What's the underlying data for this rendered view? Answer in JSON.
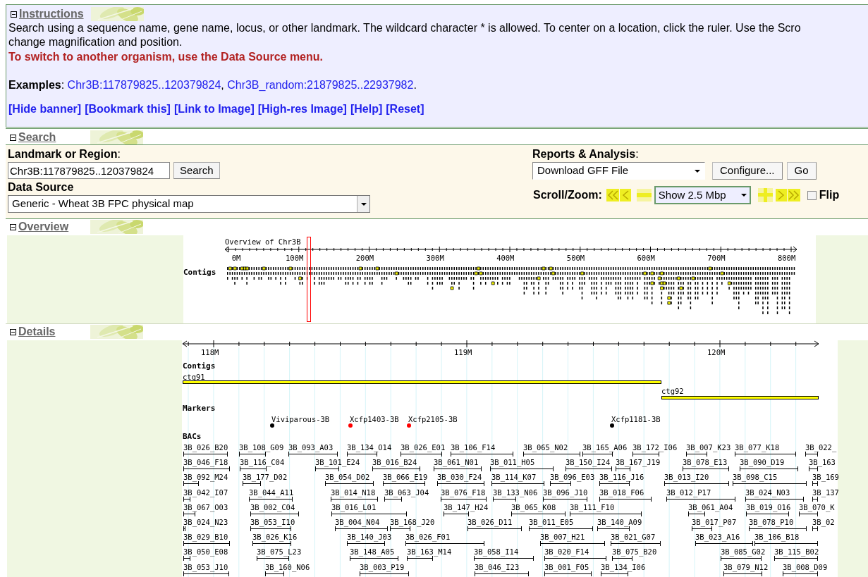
{
  "instructions": {
    "title": "Instructions",
    "expanded": true,
    "lines": [
      "Search using a sequence name, gene name, locus, or other landmark. The wildcard character * is allowed. To center on a location, click the ruler. Use the Scro",
      "change magnification and position."
    ],
    "notice": "To switch to another organism, use the Data Source menu.",
    "examples": [
      {
        "kind": "plain",
        "text": "**Examples**: "
      },
      {
        "kind": "link",
        "text": "Chr3B:117879825..120379824"
      },
      {
        "kind": "plain",
        "text": ", "
      },
      {
        "kind": "link",
        "text": "Chr3B_random:21879825..22937982"
      },
      {
        "kind": "plain",
        "text": "."
      }
    ],
    "links": [
      "[Hide banner]",
      "[Bookmark this]",
      "[Link to Image]",
      "[High-res Image]",
      "[Help]",
      "[Reset]"
    ]
  },
  "search": {
    "title": "Search",
    "expanded": true,
    "landmark_label": "**Landmark or Region**:",
    "landmark_value": "Chr3B:117879825..120379824",
    "search_button": "Search",
    "data_source_label": "Data Source",
    "data_source": "Generic - Wheat 3B FPC physical map",
    "reports_label": "**Reports & Analysis**:",
    "reports_value": "Download GFF File",
    "configure_button": "Configure...",
    "go_button": "Go",
    "scroll_zoom_label": "Scroll/Zoom:",
    "zoom_value": "Show 2.5 Mbp",
    "flip": {
      "label": "Flip",
      "checked": false
    }
  },
  "overview": {
    "title": "Overview",
    "expanded": true,
    "caption": "Overview of Chr3B",
    "ticks": [
      "0M",
      "100M",
      "200M",
      "300M",
      "400M",
      "500M",
      "600M",
      "700M",
      "800M"
    ],
    "track": "Contigs"
  },
  "details": {
    "title": "Details",
    "expanded": true,
    "ticks": [
      "118M",
      "119M",
      "120M"
    ],
    "contigs": {
      "label": "Contigs",
      "features": [
        "ctg91",
        "ctg92"
      ]
    },
    "markers": {
      "label": "Markers",
      "features": [
        {
          "label": "Viviparous-3B",
          "color": "#000000"
        },
        {
          "label": "Xcfp1403-3B",
          "color": "#ff0000"
        },
        {
          "label": "Xcfp2105-3B",
          "color": "#ff0000"
        },
        {
          "label": "Xcfp1181-3B",
          "color": "#000000"
        }
      ]
    },
    "bacs": {
      "label": "BACs",
      "features": [
        "3B_026_B20",
        "3B_108_G09",
        "3B_093_A03",
        "3B_134_O14",
        "3B_026_E01",
        "3B_106_F14",
        "3B_065_N02",
        "3B_165_A06",
        "3B_172_I06",
        "3B_007_K23",
        "3B_077_K18",
        "3B_022_",
        "3B_046_F18",
        "3B_116_C04",
        "3B_101_E24",
        "3B_016_B24",
        "3B_061_N01",
        "3B_011_H05",
        "3B_150_I24",
        "3B_167_J19",
        "3B_078_E13",
        "3B_090_D19",
        "3B_163",
        "3B_092_M24",
        "3B_177_D02",
        "3B_054_D02",
        "3B_066_E19",
        "3B_030_F24",
        "3B_114_K07",
        "3B_096_E03",
        "3B_116_J16",
        "3B_013_I20",
        "3B_098_C15",
        "3B_169",
        "3B_042_I07",
        "3B_044_A11",
        "3B_014_N18",
        "3B_063_J04",
        "3B_076_F18",
        "3B_133_N06",
        "3B_096_J10",
        "3B_018_F06",
        "3B_012_P17",
        "3B_024_N03",
        "3B_137",
        "3B_067_O03",
        "3B_002_C04",
        "3B_016_L01",
        "3B_147_H24",
        "3B_065_K08",
        "3B_111_F10",
        "3B_061_A04",
        "3B_019_O16",
        "3B_070_K",
        "3B_024_N23",
        "3B_053_I10",
        "3B_004_N04",
        "3B_168_J20",
        "3B_026_D11",
        "3B_011_E05",
        "3B_140_A09",
        "3B_017_P07",
        "3B_078_P10",
        "3B_02",
        "3B_029_B10",
        "3B_026_K16",
        "3B_140_J03",
        "3B_026_F01",
        "3B_007_H21",
        "3B_021_G07",
        "3B_023_A16",
        "3B_106_B18",
        "3B_050_E08",
        "3B_075_L23",
        "3B_148_A05",
        "3B_163_M14",
        "3B_058_I14",
        "3B_020_F14",
        "3B_075_B20",
        "3B_085_G02",
        "3B_115_B02",
        "3B_053_J10",
        "3B_160_N06",
        "3B_003_P19",
        "3B_046_I23",
        "3B_001_F05",
        "3B_134_I06",
        "3B_079_N12",
        "3B_008_D09"
      ]
    }
  }
}
